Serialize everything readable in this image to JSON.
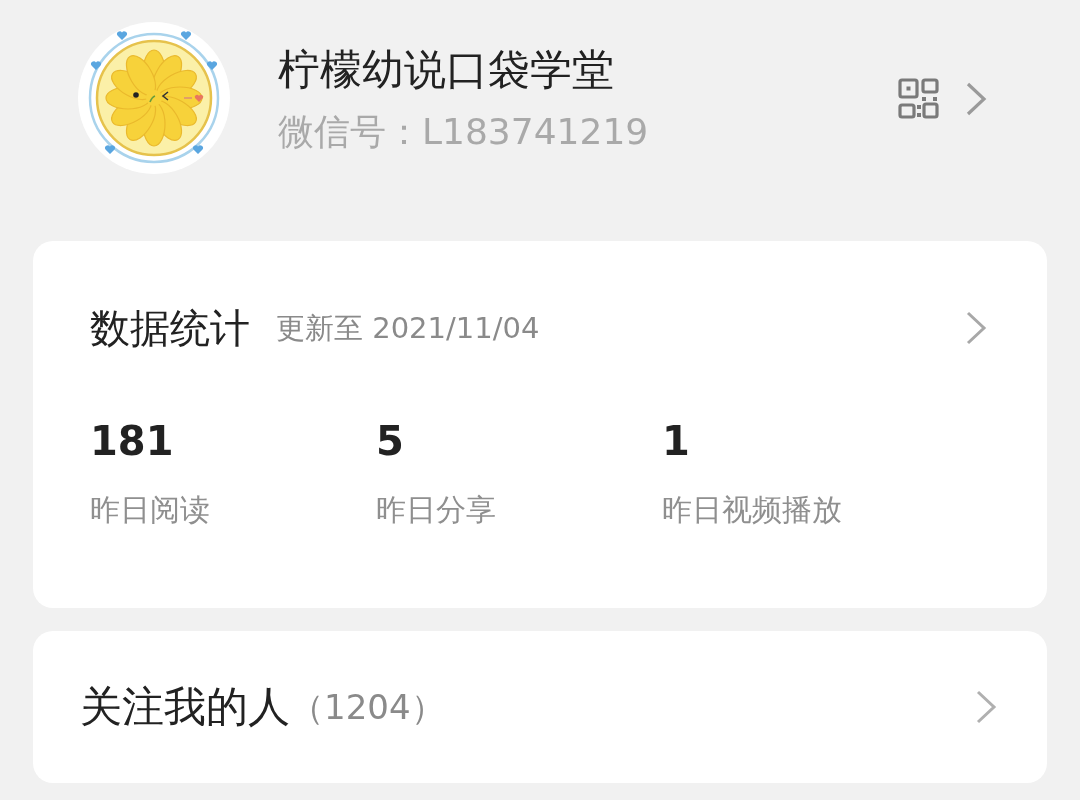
{
  "profile": {
    "name": "柠檬幼说口袋学堂",
    "wechat_id": "微信号：L183741219"
  },
  "stats_card": {
    "title": "数据统计",
    "updated": "更新至 2021/11/04",
    "stats": [
      {
        "value": "181",
        "label": "昨日阅读"
      },
      {
        "value": "5",
        "label": "昨日分享"
      },
      {
        "value": "1",
        "label": "昨日视频播放"
      }
    ]
  },
  "followers_card": {
    "label": "关注我的人",
    "count": "（1204）"
  }
}
